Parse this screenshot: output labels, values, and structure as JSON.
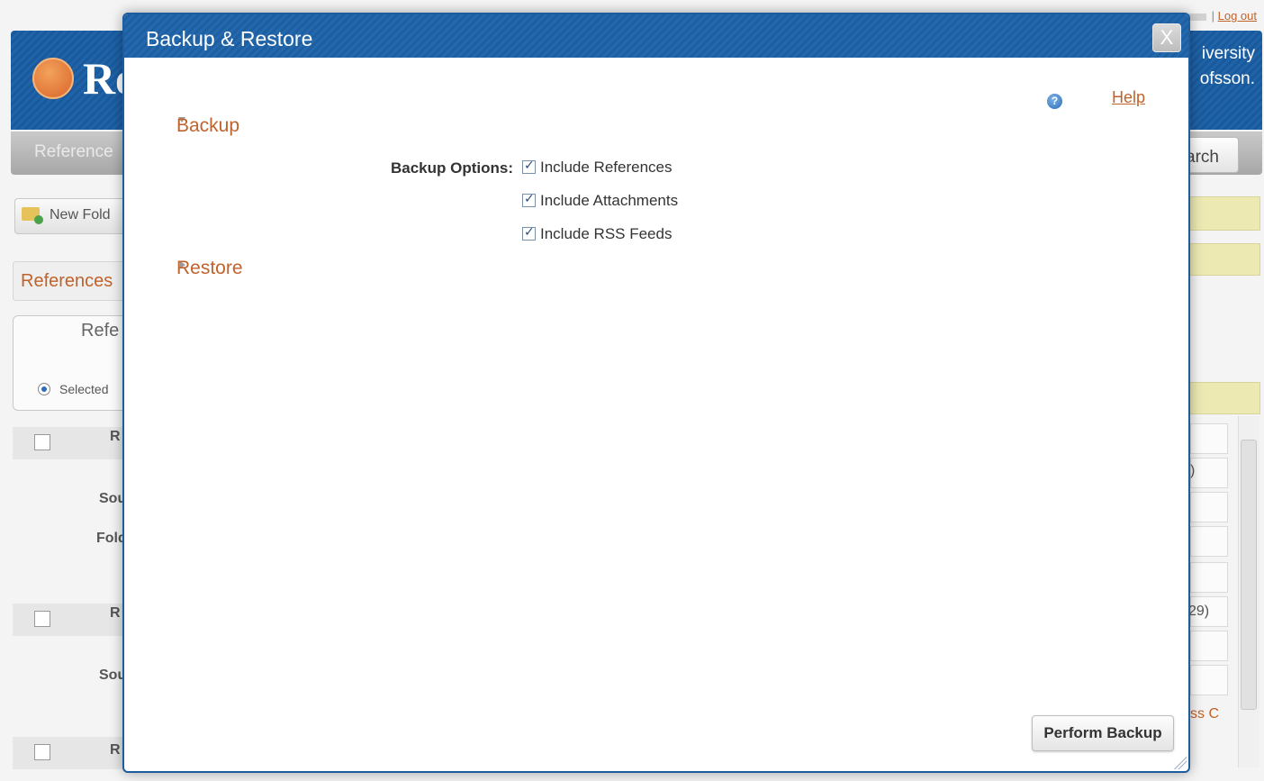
{
  "background": {
    "top_links": {
      "logout": "Log out"
    },
    "logo_fragment": "Re",
    "university_fragment_1": "iversity",
    "university_fragment_2": "ofsson.",
    "nav_left_fragment": "Reference",
    "nav_right_fragment": "arch",
    "new_folder_fragment": "New Fold",
    "references_tab": "References",
    "refs_panel_title_fragment": "Refe",
    "selected_radio_label": "Selected",
    "row_fragments": [
      "R",
      "Sou",
      "Fold",
      "R",
      "Sou",
      "R"
    ],
    "right_fragments": [
      ")",
      "29)",
      "ss C"
    ]
  },
  "modal": {
    "title": "Backup & Restore",
    "close_label": "X",
    "help_label": "Help",
    "backup_section": {
      "label": "Backup",
      "expanded": true,
      "options_label": "Backup Options:",
      "options": [
        {
          "label": "Include References",
          "checked": true
        },
        {
          "label": "Include Attachments",
          "checked": true
        },
        {
          "label": "Include RSS Feeds",
          "checked": true
        }
      ]
    },
    "restore_section": {
      "label": "Restore",
      "expanded": false
    },
    "perform_button": "Perform Backup"
  },
  "colors": {
    "accent_link": "#c0622b",
    "title_bar": "#1f63a8",
    "yellow_panel": "#ece9b3"
  }
}
